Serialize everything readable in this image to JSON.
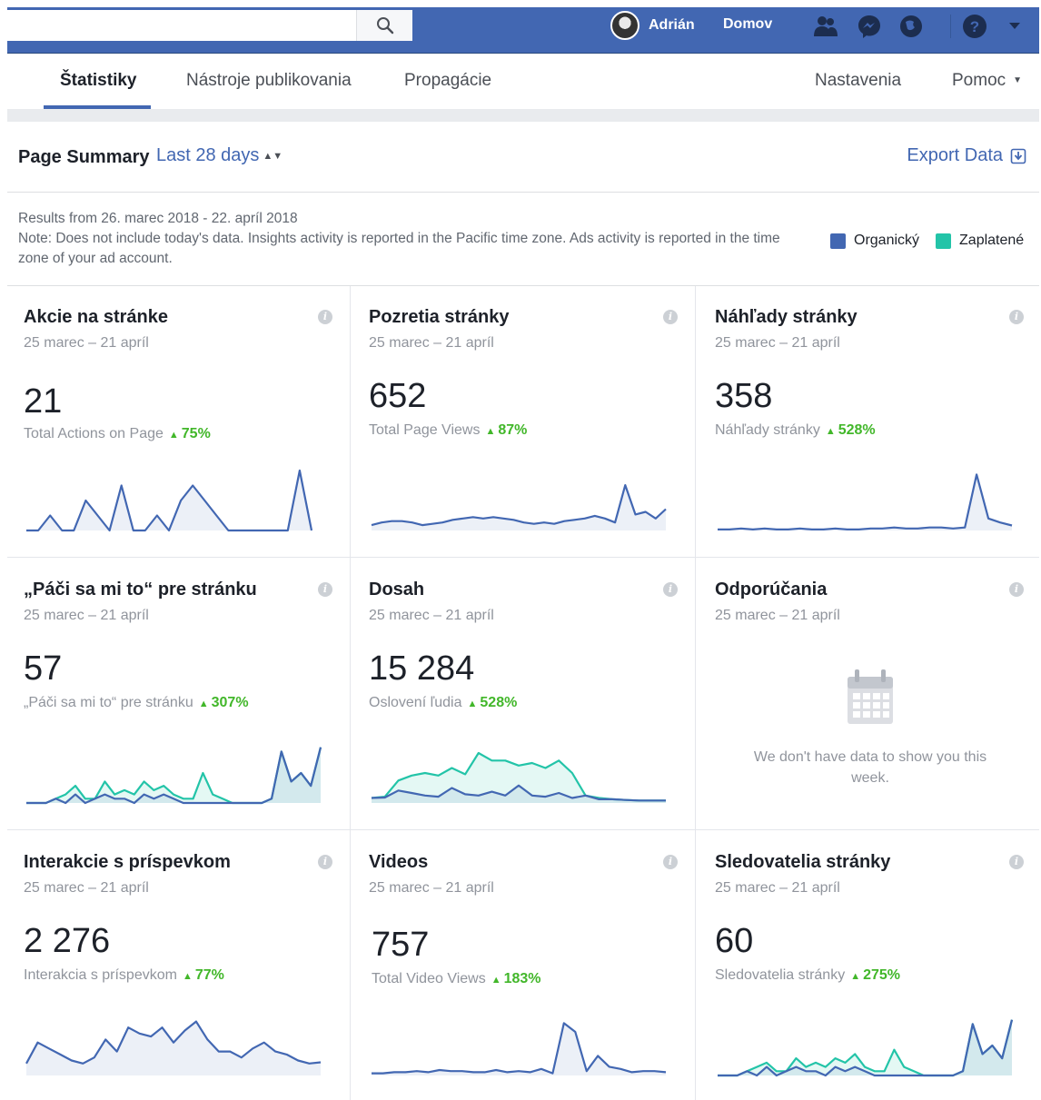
{
  "topbar": {
    "user_name": "Adrián",
    "home_label": "Domov",
    "icons": [
      "search-icon",
      "friends-icon",
      "messenger-icon",
      "globe-icon",
      "help-icon",
      "chevron-down-icon"
    ]
  },
  "subnav": {
    "tabs": [
      "Štatistiky",
      "Nástroje publikovania",
      "Propagácie"
    ],
    "settings": "Nastavenia",
    "help": "Pomoc"
  },
  "summary": {
    "title": "Page Summary",
    "range": "Last 28 days",
    "export": "Export Data"
  },
  "notes": {
    "results": "Results from 26. marec 2018 - 22. apríl 2018",
    "note": "Note: Does not include today's data. Insights activity is reported in the Pacific time zone. Ads activity is reported in the time zone of your ad account."
  },
  "legend": {
    "organic": "Organický",
    "paid": "Zaplatené",
    "organic_color": "#4267b2",
    "paid_color": "#23c4a8"
  },
  "cards": [
    {
      "title": "Akcie na stránke",
      "range": "25 marec – 21 apríl",
      "value": "21",
      "sub": "Total Actions on Page",
      "delta": "75%"
    },
    {
      "title": "Pozretia stránky",
      "range": "25 marec – 21 apríl",
      "value": "652",
      "sub": "Total Page Views",
      "delta": "87%"
    },
    {
      "title": "Náhľady stránky",
      "range": "25 marec – 21 apríl",
      "value": "358",
      "sub": "Náhľady stránky",
      "delta": "528%"
    },
    {
      "title": "„Páči sa mi to“ pre stránku",
      "range": "25 marec – 21 apríl",
      "value": "57",
      "sub": "„Páči sa mi to“ pre stránku",
      "delta": "307%"
    },
    {
      "title": "Dosah",
      "range": "25 marec – 21 apríl",
      "value": "15 284",
      "sub": "Oslovení ľudia",
      "delta": "528%"
    },
    {
      "title": "Odporúčania",
      "range": "25 marec – 21 apríl",
      "nodata": "We don't have data to show you this week."
    },
    {
      "title": "Interakcie s príspevkom",
      "range": "25 marec – 21 apríl",
      "value": "2 276",
      "sub": "Interakcia s príspevkom",
      "delta": "77%"
    },
    {
      "title": "Videos",
      "range": "25 marec – 21 apríl",
      "value": "757",
      "sub": "Total Video Views",
      "delta": "183%"
    },
    {
      "title": "Sledovatelia stránky",
      "range": "25 marec – 21 apríl",
      "value": "60",
      "sub": "Sledovatelia stránky",
      "delta": "275%"
    }
  ],
  "chart_data": [
    {
      "type": "line",
      "series": [
        {
          "values": [
            0,
            0,
            1,
            0,
            0,
            2,
            1,
            0,
            3,
            0,
            0,
            1,
            0,
            2,
            3,
            2,
            1,
            0,
            0,
            0,
            0,
            0,
            0,
            4,
            0
          ]
        }
      ],
      "ylim": [
        0,
        4
      ]
    },
    {
      "type": "line",
      "series": [
        {
          "values": [
            4,
            6,
            7,
            7,
            6,
            4,
            5,
            6,
            8,
            9,
            10,
            9,
            10,
            9,
            8,
            6,
            5,
            6,
            5,
            7,
            8,
            9,
            11,
            9,
            6,
            34,
            12,
            14,
            9,
            16
          ]
        }
      ],
      "ylim": [
        0,
        45
      ]
    },
    {
      "type": "line",
      "series": [
        {
          "values": [
            1,
            1,
            2,
            1,
            2,
            1,
            1,
            2,
            1,
            1,
            2,
            1,
            1,
            2,
            2,
            3,
            2,
            2,
            3,
            3,
            2,
            3,
            56,
            12,
            8,
            5
          ]
        }
      ],
      "ylim": [
        0,
        60
      ]
    },
    {
      "type": "line",
      "series": [
        {
          "values": [
            0,
            0,
            0,
            1,
            0,
            2,
            0,
            1,
            2,
            1,
            1,
            0,
            2,
            1,
            2,
            1,
            0,
            0,
            0,
            0,
            0,
            0,
            0,
            0,
            0,
            1,
            12,
            5,
            7,
            4,
            13
          ]
        },
        {
          "values": [
            0,
            0,
            0,
            1,
            2,
            4,
            1,
            1,
            5,
            2,
            3,
            2,
            5,
            3,
            4,
            2,
            1,
            1,
            7,
            2,
            1,
            0,
            0,
            0,
            0,
            1,
            12,
            5,
            7,
            4,
            13
          ]
        }
      ],
      "ylim": [
        0,
        14
      ]
    },
    {
      "type": "line",
      "series": [
        {
          "values": [
            200,
            220,
            500,
            400,
            300,
            250,
            600,
            350,
            300,
            450,
            300,
            700,
            300,
            250,
            400,
            200,
            300,
            150,
            150,
            120,
            100,
            100,
            100
          ]
        },
        {
          "values": [
            200,
            250,
            900,
            1100,
            1200,
            1100,
            1400,
            1150,
            2000,
            1700,
            1700,
            1500,
            1600,
            1400,
            1700,
            1200,
            300,
            200,
            150,
            120,
            100,
            100,
            100
          ]
        }
      ],
      "ylim": [
        0,
        2400
      ]
    },
    null,
    {
      "type": "line",
      "series": [
        {
          "values": [
            20,
            55,
            45,
            35,
            25,
            20,
            30,
            60,
            40,
            80,
            70,
            65,
            80,
            55,
            75,
            90,
            60,
            40,
            40,
            30,
            45,
            55,
            40,
            35,
            25,
            20,
            22
          ]
        }
      ],
      "ylim": [
        0,
        100
      ]
    },
    {
      "type": "line",
      "series": [
        {
          "values": [
            2,
            2,
            3,
            3,
            4,
            3,
            5,
            4,
            4,
            3,
            3,
            5,
            3,
            4,
            3,
            6,
            2,
            48,
            40,
            4,
            18,
            8,
            6,
            3,
            4,
            4,
            3
          ]
        }
      ],
      "ylim": [
        0,
        55
      ]
    },
    {
      "type": "line",
      "series": [
        {
          "values": [
            0,
            0,
            0,
            1,
            0,
            2,
            0,
            1,
            2,
            1,
            1,
            0,
            2,
            1,
            2,
            1,
            0,
            0,
            0,
            0,
            0,
            0,
            0,
            0,
            0,
            1,
            12,
            5,
            7,
            4,
            13
          ]
        },
        {
          "values": [
            0,
            0,
            0,
            1,
            2,
            3,
            1,
            1,
            4,
            2,
            3,
            2,
            4,
            3,
            5,
            2,
            1,
            1,
            6,
            2,
            1,
            0,
            0,
            0,
            0,
            1,
            12,
            5,
            7,
            4,
            13
          ]
        }
      ],
      "ylim": [
        0,
        14
      ]
    }
  ]
}
